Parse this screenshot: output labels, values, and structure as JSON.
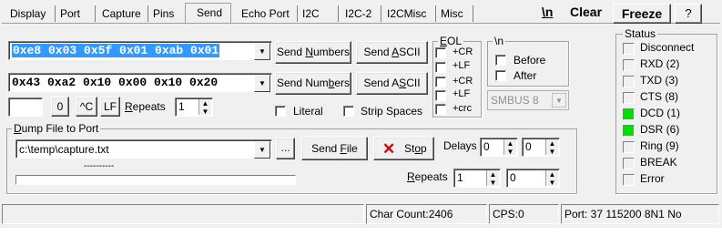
{
  "tabs": [
    "Display",
    "Port",
    "Capture",
    "Pins",
    "Send",
    "Echo Port",
    "I2C",
    "I2C-2",
    "I2CMisc",
    "Misc"
  ],
  "top_buttons": {
    "newline": "\\n",
    "clear": "Clear",
    "freeze": "Freeze",
    "help": "?"
  },
  "send": {
    "row1_value": "0xe8 0x03 0x5f 0x01 0xab 0x01",
    "row2_value": "0x43 0xa2 0x10 0x00 0x10 0x20",
    "send_numbers_1": "Send Numbers",
    "send_ascii_1": "Send ASCII",
    "send_numbers_2": "Send Numbers",
    "send_ascii_2": "Send ASCII",
    "small_input": "",
    "zero_btn": "0",
    "ctrl_c_btn": "^C",
    "lf_btn": "LF",
    "repeats_label": "Repeats",
    "repeats_value": "1",
    "literal_label": "Literal",
    "strip_spaces_label": "Strip Spaces"
  },
  "eol": {
    "title": "EOL",
    "cr1": "+CR",
    "lf1": "+LF",
    "cr2": "+CR",
    "lf2": "+LF",
    "crc": "+crc"
  },
  "newline_group": {
    "title": "\\n",
    "before": "Before",
    "after": "After",
    "smbus": "SMBUS 8"
  },
  "dump": {
    "title": "Dump File to Port",
    "path": "c:\\temp\\capture.txt",
    "browse": "...",
    "send_file": "Send File",
    "stop": "Stop",
    "delays_label": "Delays",
    "delay1": "0",
    "delay2": "0",
    "progress_text": "----------",
    "repeats_label": "Repeats",
    "repeats1": "1",
    "repeats2": "0"
  },
  "status": {
    "title": "Status",
    "items": [
      {
        "label": "Disconnect",
        "on": false
      },
      {
        "label": "RXD (2)",
        "on": false
      },
      {
        "label": "TXD (3)",
        "on": false
      },
      {
        "label": "CTS (8)",
        "on": false
      },
      {
        "label": "DCD (1)",
        "on": true
      },
      {
        "label": "DSR (6)",
        "on": true
      },
      {
        "label": "Ring (9)",
        "on": false
      },
      {
        "label": "BREAK",
        "on": false
      },
      {
        "label": "Error",
        "on": false
      }
    ],
    "on_color": "#00dd00"
  },
  "statusbar": {
    "char_count": "Char Count:2406",
    "cps": "CPS:0",
    "port": "Port: 37 115200 8N1 No"
  }
}
